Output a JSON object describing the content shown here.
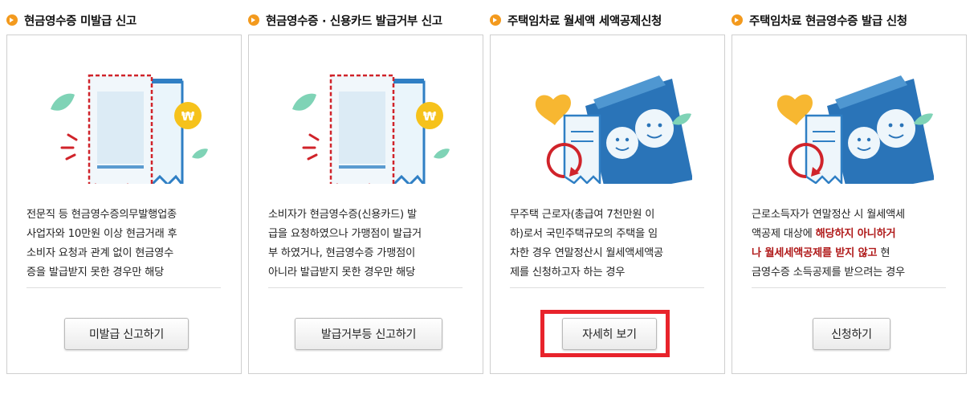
{
  "cards": [
    {
      "title": "현금영수증 미발급 신고",
      "lines": [
        "전문직 등 현금영수증의무발행업종",
        "사업자와 10만원 이상 현금거래 후",
        "소비자 요청과 관계 없이 현금영수",
        "증을 발급받지 못한 경우만 해당"
      ],
      "button": "미발급 신고하기"
    },
    {
      "title": "현금영수증 · 신용카드 발급거부 신고",
      "lines": [
        "소비자가 현금영수증(신용카드) 발",
        "급을 요청하였으나 가맹점이 발급거",
        "부 하였거나, 현금영수증 가맹점이",
        "아니라 발급받지 못한 경우만 해당"
      ],
      "button": "발급거부등 신고하기"
    },
    {
      "title": "주택임차료 월세액 세액공제신청",
      "lines": [
        "무주택 근로자(총급여 7천만원 이",
        "하)로서 국민주택규모의 주택을 임",
        "차한 경우 연말정산시 월세액세액공",
        "제를 신청하고자 하는 경우"
      ],
      "button": "자세히 보기"
    },
    {
      "title": "주택임차료 현금영수증 발급 신청",
      "lines": {
        "l1": "근로소득자가 연말정산 시 월세액세",
        "l2a": "액공제 대상에 ",
        "l2b": "해당하지 아니하거",
        "l3a": "나 월세세액공제를 받지 않고",
        "l3b": " 현",
        "l4": "금영수증 소득공제를 받으려는 경우"
      },
      "button": "신청하기"
    }
  ],
  "colors": {
    "bullet": "#f39a1e",
    "highlight_text": "#b01a1a",
    "focus_frame": "#e8232b",
    "border": "#cfcfcf"
  },
  "icons": [
    "receipt-icon",
    "coin-icon",
    "leaf-icon",
    "heart-icon",
    "envelope-icon",
    "refresh-arrow-icon",
    "smiley-face-icon"
  ]
}
